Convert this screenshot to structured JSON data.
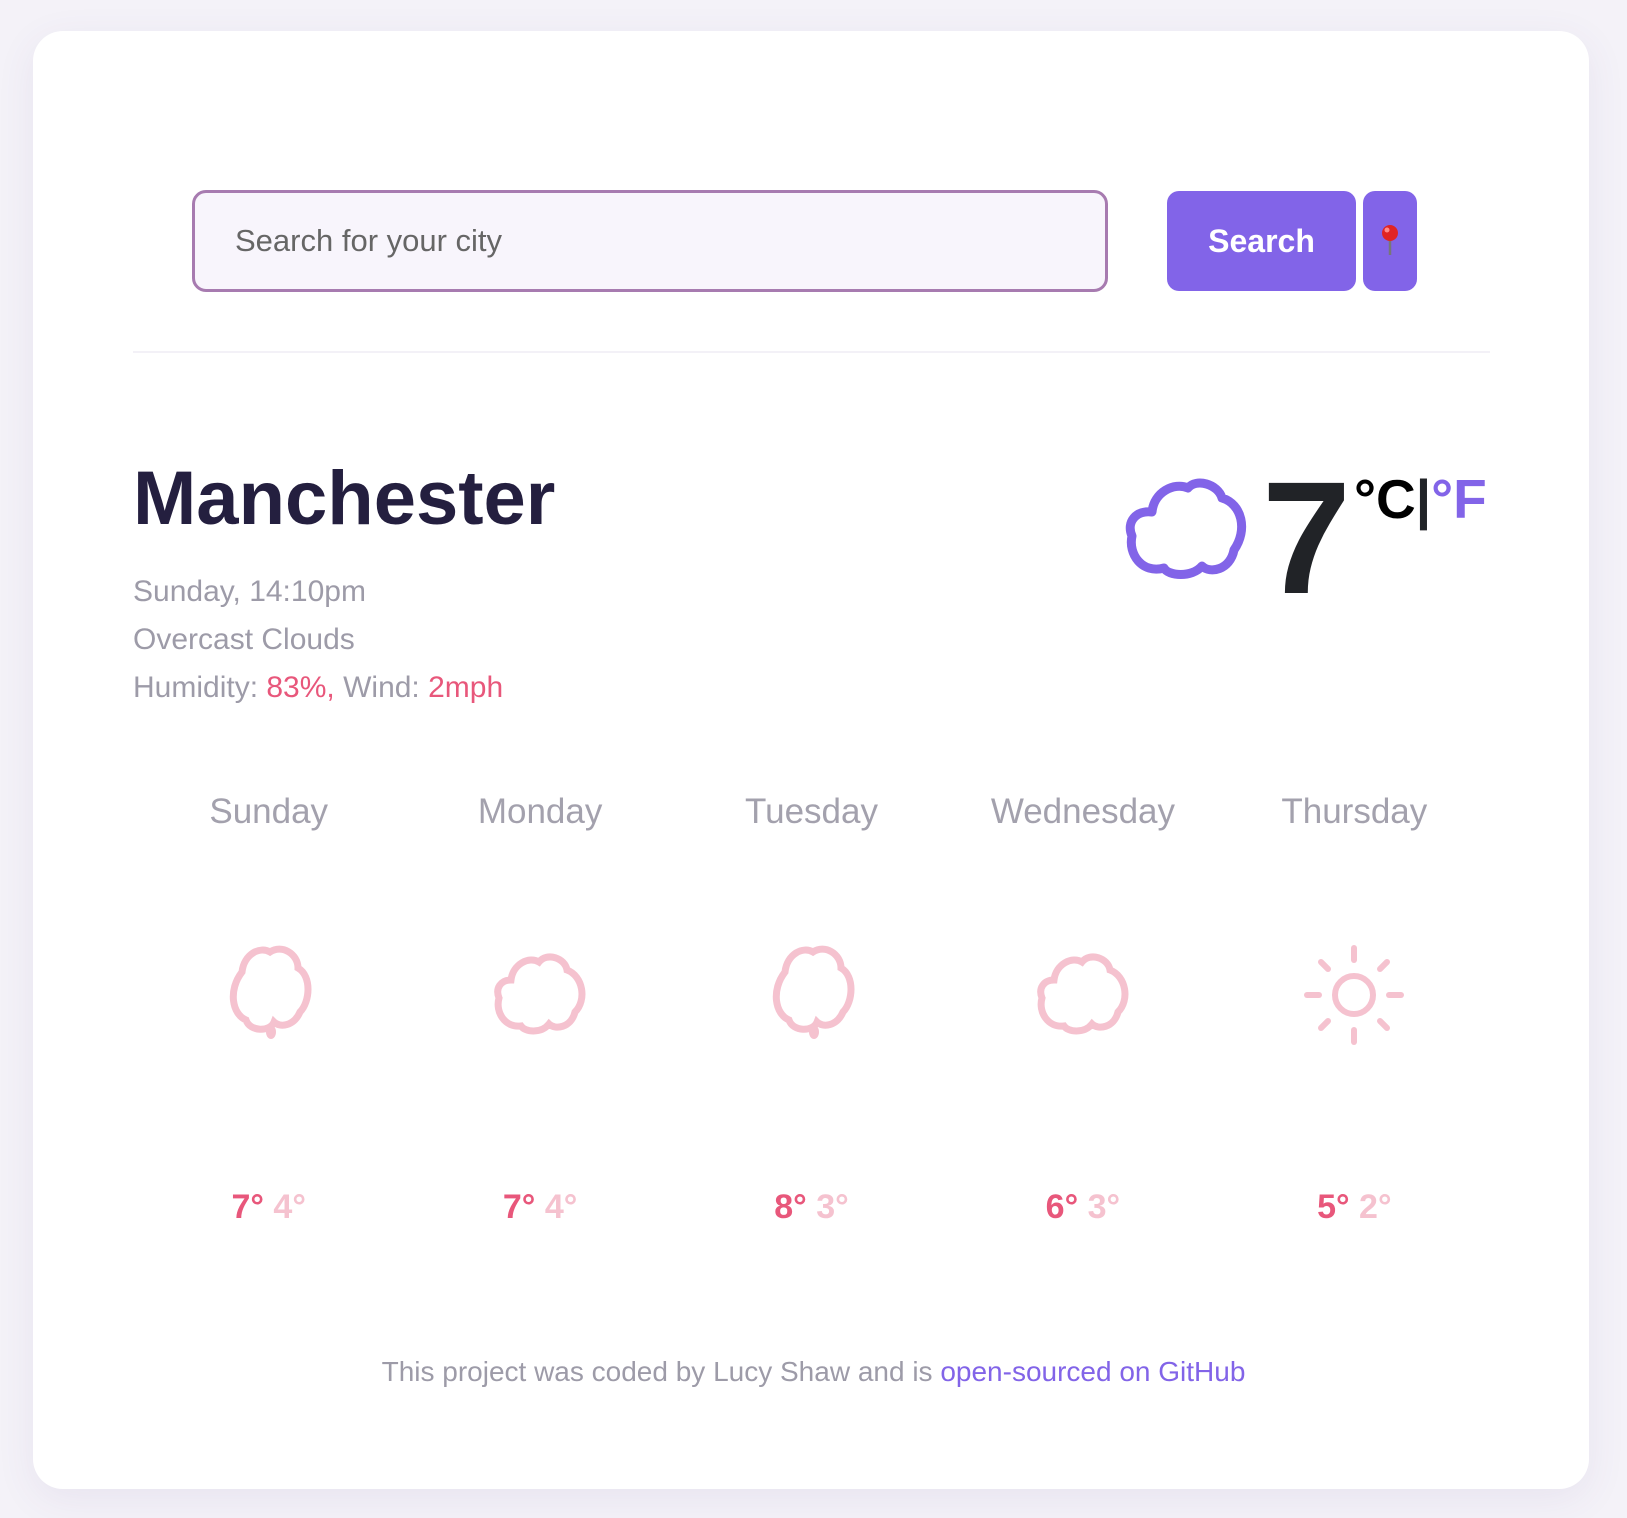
{
  "search": {
    "placeholder": "Search for your city",
    "button_label": "Search",
    "location_icon": "round-pushpin-icon"
  },
  "colors": {
    "accent": "#8264e8",
    "highlight": "#e8577b",
    "low": "#f5c2cf"
  },
  "current": {
    "city": "Manchester",
    "datetime": "Sunday, 14:10pm",
    "description": "Overcast Clouds",
    "humidity_label": "Humidity: ",
    "humidity": "83%,",
    "wind_label": " Wind: ",
    "wind": "2mph",
    "temperature": "7",
    "unit_c": "°C",
    "unit_sep": "|",
    "unit_f": "°F",
    "icon": "cloud-icon"
  },
  "forecast": [
    {
      "day": "Sunday",
      "icon": "drizzle-cloud-icon",
      "high": "7°",
      "low": "4°"
    },
    {
      "day": "Monday",
      "icon": "cloud-icon",
      "high": "7°",
      "low": "4°"
    },
    {
      "day": "Tuesday",
      "icon": "drizzle-cloud-icon",
      "high": "8°",
      "low": "3°"
    },
    {
      "day": "Wednesday",
      "icon": "cloud-icon",
      "high": "6°",
      "low": "3°"
    },
    {
      "day": "Thursday",
      "icon": "sun-icon",
      "high": "5°",
      "low": "2°"
    }
  ],
  "footer": {
    "text": "This project was coded by Lucy Shaw and is ",
    "link": "open-sourced on GitHub"
  }
}
